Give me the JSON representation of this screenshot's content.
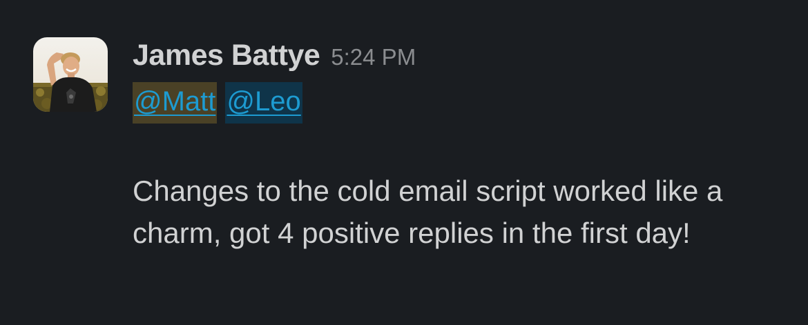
{
  "message": {
    "author": "James Battye",
    "timestamp": "5:24 PM",
    "mentions": [
      "@Matt",
      "@Leo"
    ],
    "text": "Changes to the cold email script worked like a charm, got 4 positive replies in the first day!"
  },
  "colors": {
    "background": "#1a1d21",
    "text": "#d1d2d3",
    "timestamp": "#8b8d90",
    "mention_link": "#1d9bd1",
    "mention_highlight_matt": "#4a4126",
    "mention_highlight_leo": "#0f3449"
  },
  "icons": {
    "avatar": "user-avatar-photo"
  }
}
